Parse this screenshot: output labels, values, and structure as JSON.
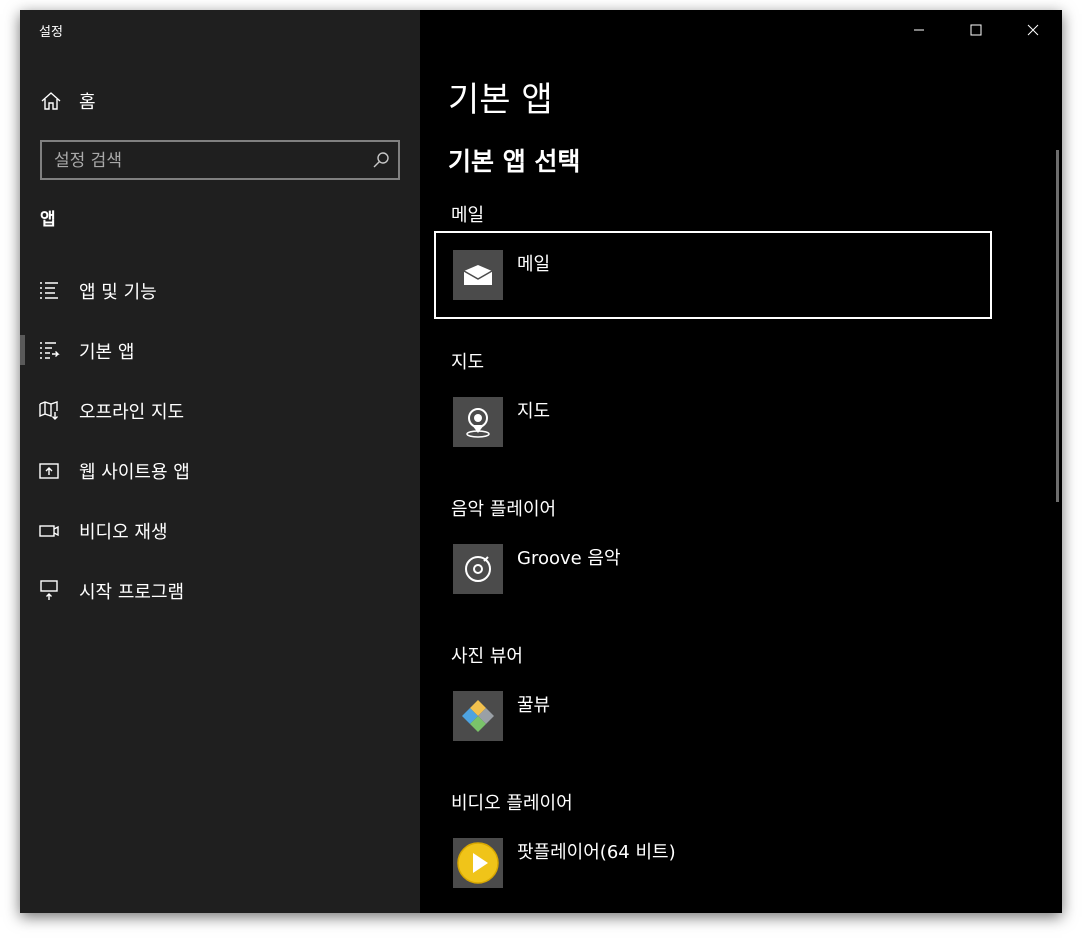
{
  "window": {
    "title": "설정"
  },
  "sidebar": {
    "home_label": "홈",
    "search_placeholder": "설정 검색",
    "section_label": "앱",
    "items": [
      {
        "label": "앱 및 기능",
        "icon": "list-icon"
      },
      {
        "label": "기본 앱",
        "icon": "default-apps-icon",
        "selected": true
      },
      {
        "label": "오프라인 지도",
        "icon": "offline-map-icon"
      },
      {
        "label": "웹 사이트용 앱",
        "icon": "web-app-icon"
      },
      {
        "label": "비디오 재생",
        "icon": "video-camera-icon"
      },
      {
        "label": "시작 프로그램",
        "icon": "startup-icon"
      }
    ]
  },
  "main": {
    "title": "기본 앱",
    "subtitle": "기본 앱 선택",
    "categories": [
      {
        "label": "메일",
        "app_name": "메일",
        "icon": "mail-icon",
        "focused": true
      },
      {
        "label": "지도",
        "app_name": "지도",
        "icon": "map-pin-icon"
      },
      {
        "label": "음악 플레이어",
        "app_name": "Groove 음악",
        "icon": "groove-music-icon"
      },
      {
        "label": "사진 뷰어",
        "app_name": "꿀뷰",
        "icon": "honeyview-icon"
      },
      {
        "label": "비디오 플레이어",
        "app_name": "팟플레이어(64 비트)",
        "icon": "potplayer-icon"
      }
    ]
  },
  "colors": {
    "sidebar_bg": "#1f1f1f",
    "main_bg": "#000000",
    "tile_bg": "#4b4b4b",
    "focus_border": "#ffffff"
  }
}
